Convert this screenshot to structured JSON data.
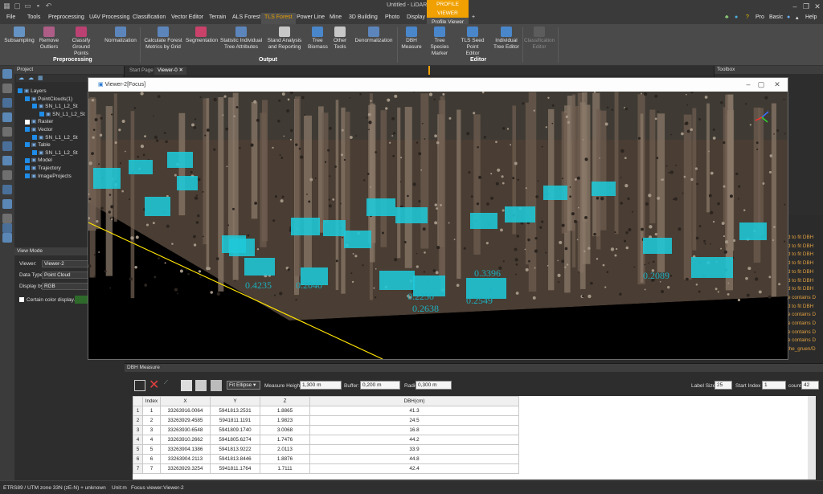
{
  "app": {
    "title": "Untitled - LiDAR360"
  },
  "window_controls": {
    "minimize": "–",
    "restore": "❐",
    "close": "✕"
  },
  "menu": {
    "items": [
      "File",
      "Tools",
      "Preprocessing",
      "UAV Processing",
      "Classification",
      "Vector Editor",
      "Terrain",
      "ALS Forest",
      "TLS Forest",
      "Power Line",
      "Mine",
      "3D Building",
      "Photo",
      "Display"
    ],
    "active": "TLS Forest",
    "profile_viewer_top": "PROFILE VIEWER",
    "profile_viewer_sub": "Profile Viewer",
    "plus": "+",
    "right": {
      "pro": "Pro",
      "basic": "Basic",
      "help": "Help"
    }
  },
  "ribbon": {
    "buttons": [
      {
        "label": "Subsampling",
        "group": "pre"
      },
      {
        "label": "Remove\nOutliers",
        "group": "pre"
      },
      {
        "label": "Classify Ground\nPoints",
        "group": "pre"
      },
      {
        "label": "Normalization",
        "group": "pre"
      },
      {
        "label": "Calculate Forest\nMetrics by Grid",
        "group": "out"
      },
      {
        "label": "Segmentation",
        "group": "out"
      },
      {
        "label": "Statistic Individual\nTree Attributes",
        "group": "out"
      },
      {
        "label": "Stand Analysis\nand Reporting",
        "group": "out"
      },
      {
        "label": "Tree\nBiomass",
        "group": "out"
      },
      {
        "label": "Other\nTools",
        "group": "out"
      },
      {
        "label": "Denormalization",
        "group": "out"
      },
      {
        "label": "DBH\nMeasure",
        "group": "ed"
      },
      {
        "label": "Tree Species\nMarker",
        "group": "ed"
      },
      {
        "label": "TLS Seed Point\nEditor",
        "group": "ed"
      },
      {
        "label": "Individual\nTree Editor",
        "group": "ed"
      },
      {
        "label": "Classification\nEditor",
        "group": "ed",
        "disabled": true
      }
    ],
    "groups": {
      "pre": "Preprocessing",
      "out": "Output",
      "ed": "Editor"
    }
  },
  "project": {
    "title": "Project",
    "tree": [
      {
        "label": "Layers",
        "depth": 0,
        "checked": true
      },
      {
        "label": "PointClouds(1)",
        "depth": 1,
        "checked": true
      },
      {
        "label": "SN_L1_L2_St",
        "depth": 2,
        "checked": true
      },
      {
        "label": "SN_L1_L2_St",
        "depth": 3,
        "checked": true
      },
      {
        "label": "Raster",
        "depth": 1,
        "checked": false
      },
      {
        "label": "Vector",
        "depth": 1,
        "checked": true
      },
      {
        "label": "SN_L1_L2_St",
        "depth": 2,
        "checked": true
      },
      {
        "label": "Table",
        "depth": 1,
        "checked": true
      },
      {
        "label": "SN_L1_L2_St",
        "depth": 2,
        "checked": true
      },
      {
        "label": "Model",
        "depth": 1,
        "checked": true
      },
      {
        "label": "Trajectory",
        "depth": 1,
        "checked": true
      },
      {
        "label": "ImageProjects",
        "depth": 1,
        "checked": true
      }
    ]
  },
  "view_mode": {
    "title": "View Mode",
    "viewer_label": "Viewer:",
    "viewer_value": "Viewer-2",
    "data_type_label": "Data Type:",
    "data_type_value": "Point Cloud",
    "display_by_label": "Display by:",
    "display_by_value": "RGB",
    "certain_color": "Certain color display."
  },
  "tabs": {
    "start_page": "Start Page",
    "viewer0": "Viewer-0",
    "close": "✕"
  },
  "toolbox": {
    "title": "Toolbox"
  },
  "viewer": {
    "title": "Viewer-2[Focus]"
  },
  "log_lines": [
    "d to fit DBH",
    "d to fit DBH",
    "d to fit DBH",
    "d to fit DBH",
    "d to fit DBH",
    "d to fit DBH",
    "d to fit DBH",
    "e contains D",
    "d to fit DBH",
    "e contains D",
    "e contains D",
    "e contains D",
    "e contains D",
    "the_gruen/D"
  ],
  "dbh_panel": {
    "title": "DBH Measure",
    "method": "Fit Ellipse",
    "measure_height_label": "Measure Height:",
    "measure_height": "1,300 m",
    "buffer_label": "Buffer:",
    "buffer": "0,200 m",
    "radius_label": "Radius:",
    "radius": "0,300 m",
    "label_size_label": "Label Size",
    "label_size": "25",
    "start_index_label": "Start Index",
    "start_index": "1",
    "count_label": "count",
    "count": "42",
    "columns": [
      "Index",
      "X",
      "Y",
      "Z",
      "DBH(cm)"
    ],
    "rows": [
      [
        "1",
        "33263916.0064",
        "5941813.2531",
        "1.8865",
        "41.3"
      ],
      [
        "2",
        "33263929.4585",
        "5941811.1191",
        "1.9823",
        "24.5"
      ],
      [
        "3",
        "33263930.6548",
        "5941809.1740",
        "3.0068",
        "16.8"
      ],
      [
        "4",
        "33263910.2662",
        "5941805.6274",
        "1.7476",
        "44.2"
      ],
      [
        "5",
        "33263904.1386",
        "5941813.9222",
        "2.0113",
        "33.9"
      ],
      [
        "6",
        "33263904.2113",
        "5941813.8446",
        "1.8876",
        "44.8"
      ],
      [
        "7",
        "33263929.3254",
        "5941811.1764",
        "1.7111",
        "42.4"
      ]
    ]
  },
  "scene_labels": [
    "0.4235",
    "0.2040",
    "0.2250",
    "0.2638",
    "0.2549",
    "0.3396",
    "0.2089"
  ],
  "status": {
    "crs": "ETRS89 / UTM zone 33N (zE-N) + unknown",
    "unit": "Unit:m",
    "focus": "Focus viewer:Viewer-2"
  },
  "colors": {
    "accent": "#f0a000",
    "cyan": "#1ec8d8",
    "ground_line": "#ffe400"
  }
}
